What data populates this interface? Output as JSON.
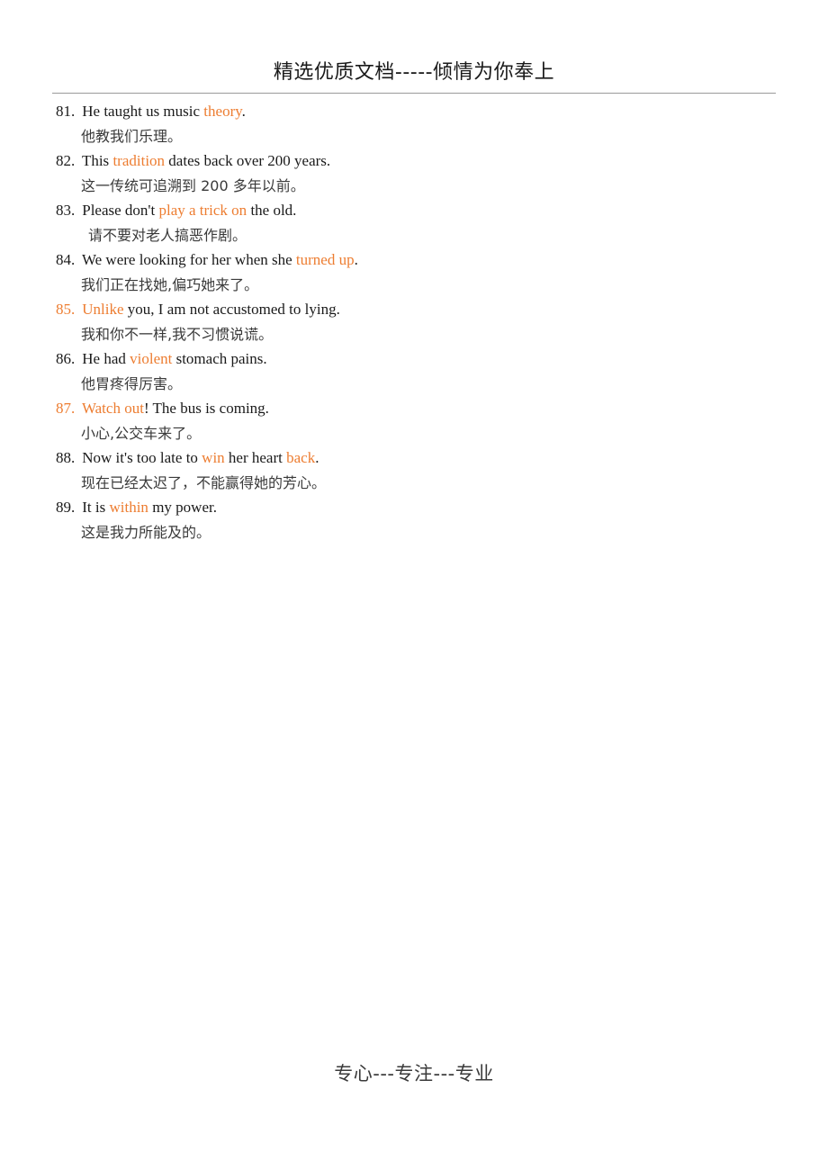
{
  "header": {
    "text": "精选优质文档-----倾情为你奉上"
  },
  "footer": {
    "text": "专心---专注---专业"
  },
  "colors": {
    "accent": "#ED7D31",
    "body_text": "#1a1a1a",
    "translation_text": "#3a3a3a",
    "rule": "#9a9a9a",
    "background": "#ffffff"
  },
  "items": [
    {
      "number": "81.",
      "number_accent": false,
      "english_parts": [
        {
          "text": "He taught us music ",
          "accent": false
        },
        {
          "text": "theory",
          "accent": true
        },
        {
          "text": ".",
          "accent": false
        }
      ],
      "english_plain": "81. He taught us music theory.",
      "chinese": "他教我们乐理。",
      "chinese_extra_indent": false
    },
    {
      "number": "82.",
      "number_accent": false,
      "english_parts": [
        {
          "text": "This ",
          "accent": false
        },
        {
          "text": "tradition",
          "accent": true
        },
        {
          "text": " dates back over 200 years.",
          "accent": false
        }
      ],
      "english_plain": "82. This tradition dates back over 200 years.",
      "chinese": "这一传统可追溯到 200 多年以前。",
      "chinese_extra_indent": false
    },
    {
      "number": "83.",
      "number_accent": false,
      "english_parts": [
        {
          "text": "Please don't ",
          "accent": false
        },
        {
          "text": "play a trick on",
          "accent": true
        },
        {
          "text": " the old.",
          "accent": false
        }
      ],
      "english_plain": "83. Please don't play a trick on the old.",
      "chinese": "请不要对老人搞恶作剧。",
      "chinese_extra_indent": true
    },
    {
      "number": "84.",
      "number_accent": false,
      "english_parts": [
        {
          "text": "We were looking for her when she ",
          "accent": false
        },
        {
          "text": "turned up",
          "accent": true
        },
        {
          "text": ".",
          "accent": false
        }
      ],
      "english_plain": "84. We were looking for her when she turned up.",
      "chinese": "我们正在找她,偏巧她来了。",
      "chinese_extra_indent": false
    },
    {
      "number": "85.",
      "number_accent": true,
      "english_parts": [
        {
          "text": "Unlike",
          "accent": true
        },
        {
          "text": " you, I am not accustomed to lying.",
          "accent": false
        }
      ],
      "english_plain": "85. Unlike you, I am not accustomed to lying.",
      "chinese": "我和你不一样,我不习惯说谎。",
      "chinese_extra_indent": false
    },
    {
      "number": "86.",
      "number_accent": false,
      "english_parts": [
        {
          "text": "He had ",
          "accent": false
        },
        {
          "text": "violent",
          "accent": true
        },
        {
          "text": " stomach pains.",
          "accent": false
        }
      ],
      "english_plain": "86. He had violent stomach pains.",
      "chinese": "他胃疼得厉害。",
      "chinese_extra_indent": false
    },
    {
      "number": "87.",
      "number_accent": true,
      "english_parts": [
        {
          "text": "Watch out",
          "accent": true
        },
        {
          "text": "! The bus is coming.",
          "accent": false
        }
      ],
      "english_plain": "87. Watch out! The bus is coming.",
      "chinese": "小心,公交车来了。",
      "chinese_extra_indent": false
    },
    {
      "number": "88.",
      "number_accent": false,
      "english_parts": [
        {
          "text": "Now it's too late to ",
          "accent": false
        },
        {
          "text": "win",
          "accent": true
        },
        {
          "text": " her heart ",
          "accent": false
        },
        {
          "text": "back",
          "accent": true
        },
        {
          "text": ".",
          "accent": false
        }
      ],
      "english_plain": "88. Now it's too late to win her heart back.",
      "chinese": "现在已经太迟了，不能赢得她的芳心。",
      "chinese_extra_indent": false
    },
    {
      "number": "89.",
      "number_accent": false,
      "english_parts": [
        {
          "text": "It is ",
          "accent": false
        },
        {
          "text": "within",
          "accent": true
        },
        {
          "text": " my power.",
          "accent": false
        }
      ],
      "english_plain": "89. It is within my power.",
      "chinese": "这是我力所能及的。",
      "chinese_extra_indent": false
    }
  ]
}
